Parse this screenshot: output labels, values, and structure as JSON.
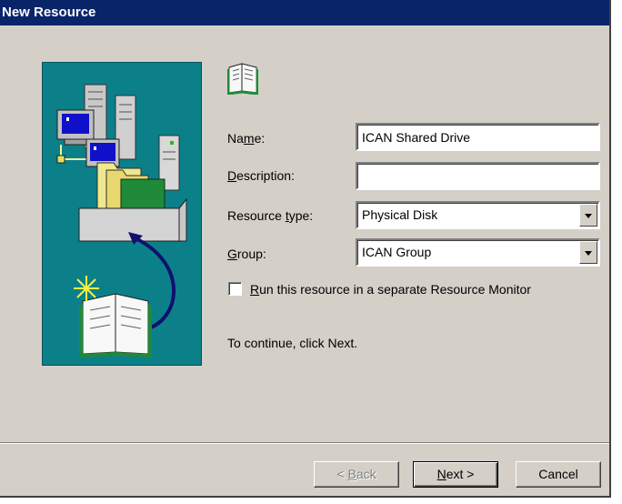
{
  "window": {
    "title": "New Resource"
  },
  "form": {
    "name_label_pre": "Na",
    "name_label_u": "m",
    "name_label_post": "e:",
    "name_value": "ICAN Shared Drive",
    "description_label_u": "D",
    "description_label_post": "escription:",
    "description_value": "",
    "resource_type_label_pre": "Resource ",
    "resource_type_label_u": "t",
    "resource_type_label_post": "ype:",
    "resource_type_value": "Physical Disk",
    "group_label_u": "G",
    "group_label_post": "roup:",
    "group_value": "ICAN Group",
    "checkbox_label_u": "R",
    "checkbox_label_post": "un this resource in a separate Resource Monitor",
    "checkbox_checked": false,
    "hint": "To continue, click Next."
  },
  "buttons": {
    "back_pre": "< ",
    "back_u": "B",
    "back_post": "ack",
    "next_u": "N",
    "next_post": "ext >",
    "cancel": "Cancel"
  },
  "icons": {
    "wizard_art": "server-folder-book-illustration",
    "header": "resource-book-icon"
  },
  "colors": {
    "titlebar": "#0a246a",
    "dialog_bg": "#d4d0c8",
    "art_bg": "#0c8088"
  }
}
